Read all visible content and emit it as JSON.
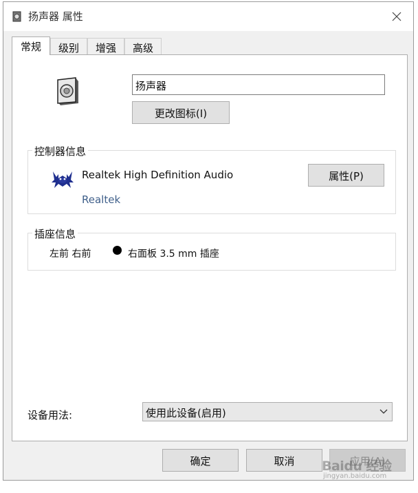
{
  "window": {
    "title": "扬声器 属性"
  },
  "tabs": [
    {
      "label": "常规",
      "active": true
    },
    {
      "label": "级别",
      "active": false
    },
    {
      "label": "增强",
      "active": false
    },
    {
      "label": "高级",
      "active": false
    }
  ],
  "general": {
    "device_name": "扬声器",
    "change_icon_label": "更改图标(I)"
  },
  "controller": {
    "legend": "控制器信息",
    "name": "Realtek High Definition Audio",
    "vendor": "Realtek",
    "properties_label": "属性(P)"
  },
  "jack": {
    "legend": "插座信息",
    "position": "左前 右前",
    "description": "右面板 3.5 mm 插座",
    "dot_color": "#000000"
  },
  "usage": {
    "label": "设备用法:",
    "selected": "使用此设备(启用)"
  },
  "buttons": {
    "ok": "确定",
    "cancel": "取消",
    "apply": "应用(A)"
  },
  "watermark": {
    "text": "Baidu 经验",
    "sub": "jingyan.baidu.com"
  },
  "colors": {
    "window_bg": "#f0f0f0",
    "panel_bg": "#ffffff",
    "vendor_text": "#3f5f8a",
    "button_bg": "#e1e1e1"
  }
}
